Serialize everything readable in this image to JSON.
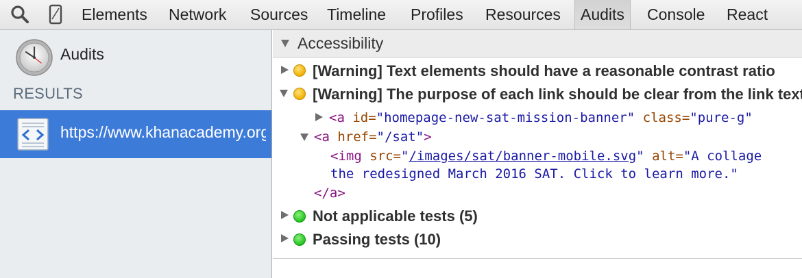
{
  "toolbar": {
    "tabs": [
      "Elements",
      "Network",
      "Sources",
      "Timeline",
      "Profiles",
      "Resources",
      "Audits",
      "Console",
      "React"
    ],
    "selected_tab": "Audits",
    "icons": [
      "search-icon",
      "device-mode-icon"
    ]
  },
  "sidebar": {
    "audits_label": "Audits",
    "results_heading": "RESULTS",
    "selected_result": "https://www.khanacademy.org"
  },
  "main": {
    "section_title": "Accessibility",
    "rules": [
      {
        "status": "warning",
        "expanded": false,
        "text": "[Warning] Text elements should have a reasonable contrast ratio"
      },
      {
        "status": "warning",
        "expanded": true,
        "text": "[Warning] The purpose of each link should be clear from the link text"
      }
    ],
    "code": {
      "line1": {
        "open": "<a",
        "attr1": "id=",
        "val1": "\"homepage-new-sat-mission-banner\"",
        "attr2": "class=",
        "val2": "\"pure-g\""
      },
      "line2": {
        "open": "<a",
        "attr1": "href=",
        "val1": "\"/sat\"",
        "close": ">"
      },
      "line3": {
        "open": "<img",
        "attr1": "src=",
        "q1": "\"",
        "link": "/images/sat/banner-mobile.svg",
        "q2": "\"",
        "attr2": "alt=",
        "val2": "\"A collage"
      },
      "line4": {
        "text": "the redesigned March 2016 SAT. Click to learn more.\""
      },
      "line5": {
        "close": "</a>"
      }
    },
    "summaries": [
      {
        "status": "pass",
        "text": "Not applicable tests (5)"
      },
      {
        "status": "pass",
        "text": "Passing tests (10)"
      }
    ]
  },
  "colors": {
    "selection_blue": "#3d7bd9",
    "warning_orange": "#f0b000",
    "pass_green": "#22c322",
    "tag_purple": "#881280",
    "attr_brown": "#994500",
    "value_blue": "#1a1aa6"
  }
}
